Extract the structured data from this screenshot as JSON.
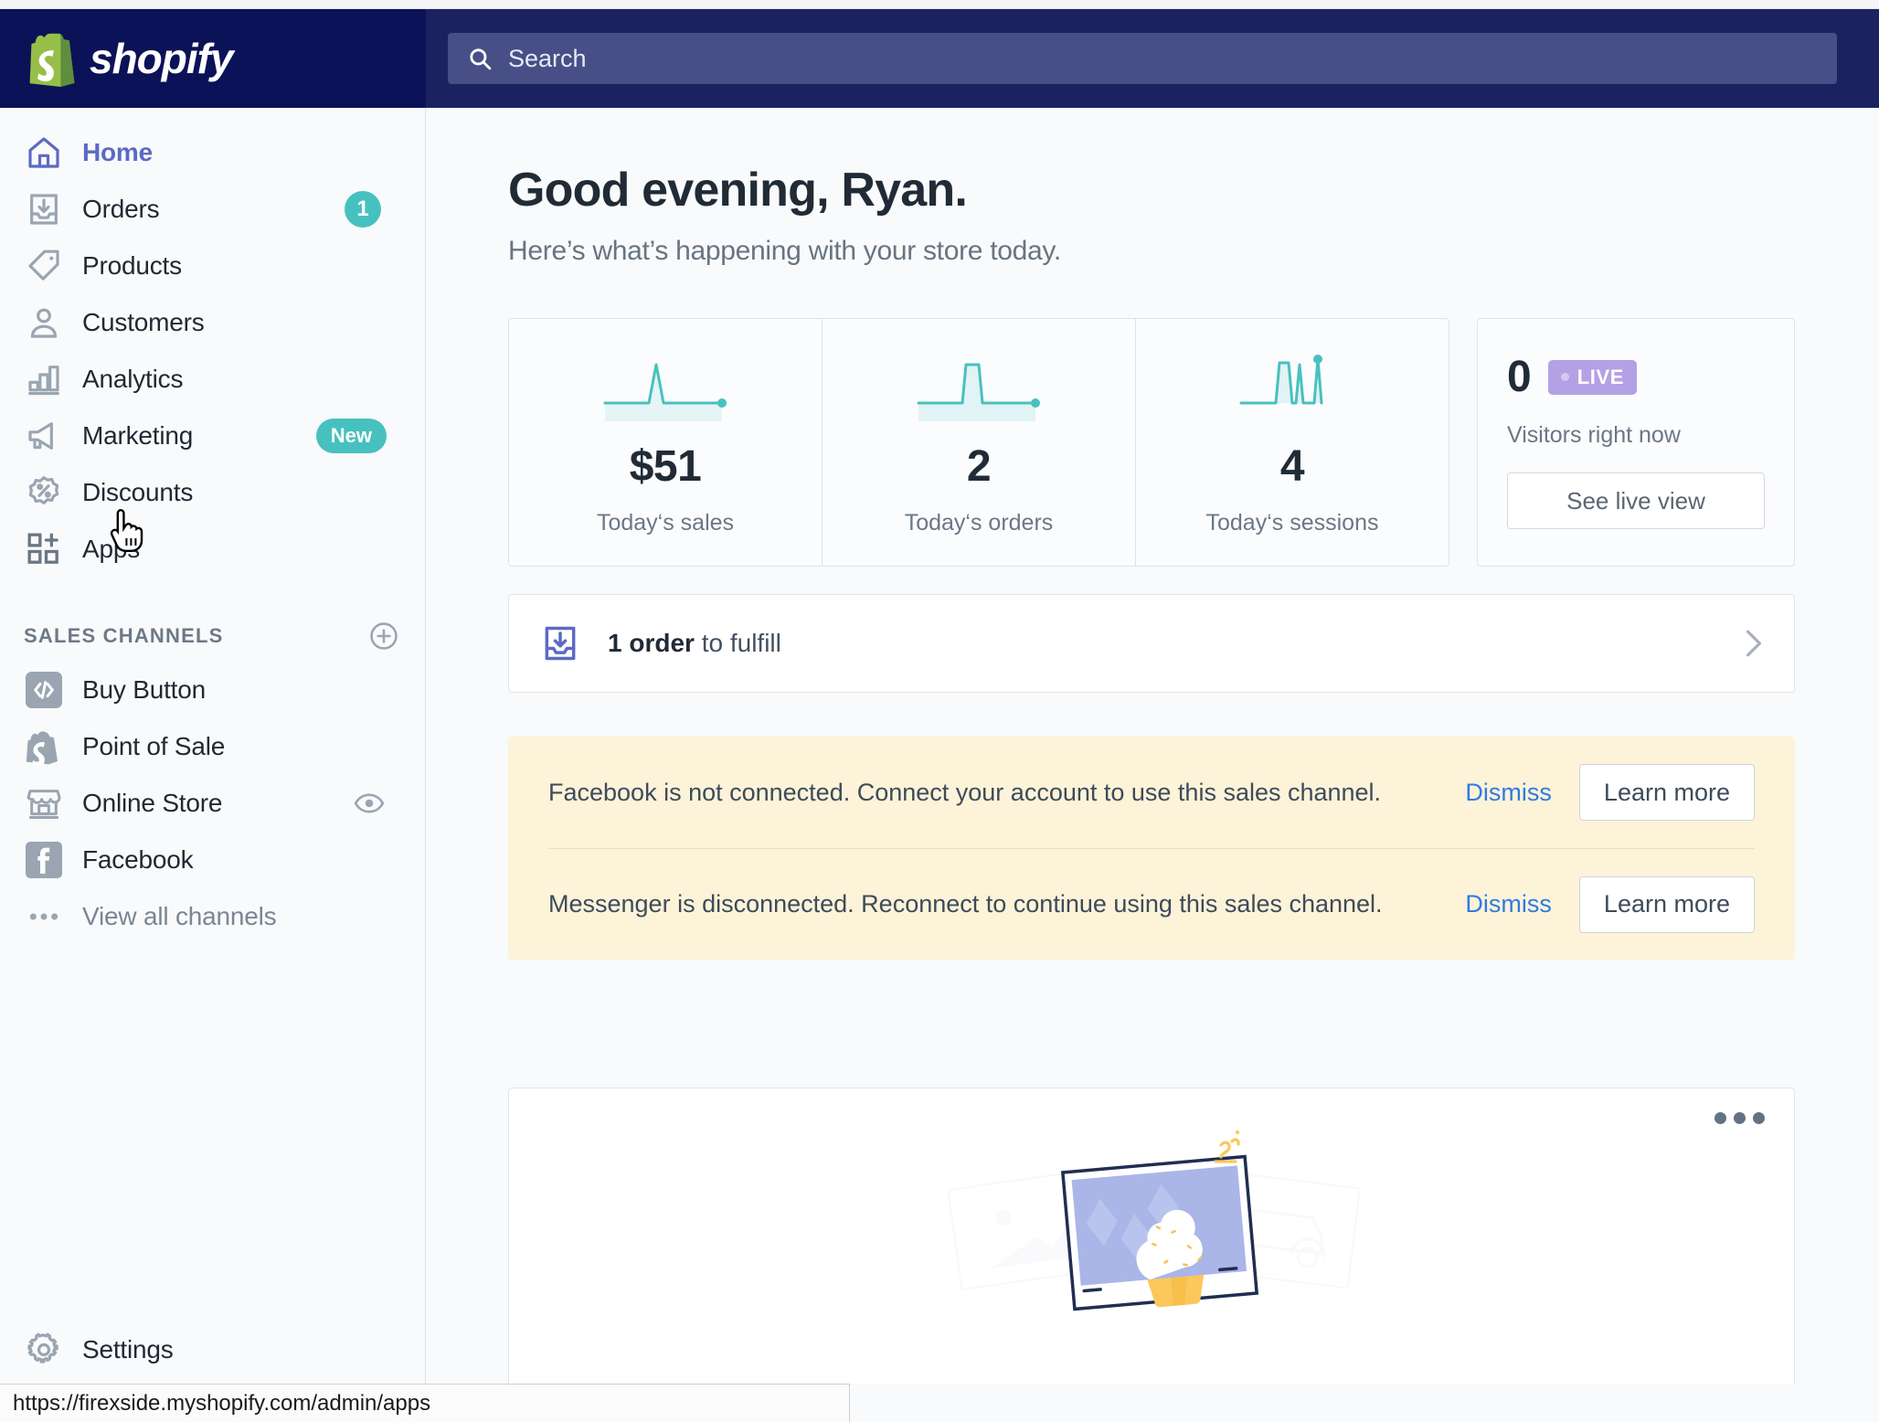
{
  "topbar": {
    "brand": "shopify",
    "search": {
      "placeholder": "Search",
      "value": "",
      "icon": "search-icon"
    }
  },
  "sidebar": {
    "main_items": [
      {
        "label": "Home",
        "icon": "home-icon",
        "active": true,
        "badge": null
      },
      {
        "label": "Orders",
        "icon": "orders-icon",
        "active": false,
        "badge": "1"
      },
      {
        "label": "Products",
        "icon": "tag-icon",
        "active": false,
        "badge": null
      },
      {
        "label": "Customers",
        "icon": "person-icon",
        "active": false,
        "badge": null
      },
      {
        "label": "Analytics",
        "icon": "bar-chart-icon",
        "active": false,
        "badge": null
      },
      {
        "label": "Marketing",
        "icon": "megaphone-icon",
        "active": false,
        "badge": "New"
      },
      {
        "label": "Discounts",
        "icon": "percent-icon",
        "active": false,
        "badge": null
      },
      {
        "label": "Apps",
        "icon": "apps-grid-icon",
        "active": false,
        "badge": null
      }
    ],
    "section": {
      "title": "SALES CHANNELS",
      "add_icon": "plus-circle-icon"
    },
    "channels": [
      {
        "label": "Buy Button",
        "icon": "code-icon"
      },
      {
        "label": "Point of Sale",
        "icon": "pos-bag-icon"
      },
      {
        "label": "Online Store",
        "icon": "storefront-icon",
        "trailing_icon": "eye-icon"
      },
      {
        "label": "Facebook",
        "icon": "facebook-icon"
      }
    ],
    "view_all": {
      "label": "View all channels",
      "icon": "ellipsis-icon"
    },
    "settings": {
      "label": "Settings",
      "icon": "gear-icon"
    }
  },
  "main": {
    "greeting": "Good evening, Ryan.",
    "subgreeting": "Here’s what’s happening with your store today.",
    "stats": [
      {
        "value": "$51",
        "label": "Today‘s sales"
      },
      {
        "value": "2",
        "label": "Today‘s orders"
      },
      {
        "value": "4",
        "label": "Today‘s sessions"
      }
    ],
    "live": {
      "count": "0",
      "badge": "LIVE",
      "caption": "Visitors right now",
      "button": "See live view"
    },
    "fulfill": {
      "bold": "1 order",
      "rest": " to fulfill",
      "icon": "orders-icon",
      "chevron": "chevron-right-icon"
    },
    "banners": [
      {
        "message": "Facebook is not connected. Connect your account to use this sales channel.",
        "dismiss": "Dismiss",
        "action": "Learn more"
      },
      {
        "message": "Messenger is disconnected. Reconnect to continue using this sales channel.",
        "dismiss": "Dismiss",
        "action": "Learn more"
      }
    ],
    "photo_card": {
      "menu_icon": "ellipsis-icon",
      "illustration": "cupcake-photo-illustration"
    }
  },
  "statusbar": {
    "url": "https://firexside.myshopify.com/admin/apps"
  },
  "colors": {
    "brand_navy": "#0b1258",
    "topbar_navy": "#1c2260",
    "search_field": "#474f86",
    "accent_indigo": "#5c6ac4",
    "badge_teal": "#47c1bf",
    "live_purple": "#b4a0e5",
    "banner_cream": "#fcf3d9",
    "link_blue": "#2d7ce0",
    "spark_teal": "#47c1bf"
  },
  "chart_data": [
    {
      "type": "line",
      "title": "Today‘s sales",
      "x": [
        0,
        1,
        2,
        3,
        4,
        5,
        6,
        7,
        8,
        9,
        10
      ],
      "values": [
        0,
        0,
        0,
        0,
        0,
        0,
        1,
        0,
        0,
        0,
        0
      ],
      "ylim": [
        0,
        1
      ],
      "grid": false,
      "annotation": "end-point marker at final value"
    },
    {
      "type": "line",
      "title": "Today‘s orders",
      "x": [
        0,
        1,
        2,
        3,
        4,
        5,
        6,
        7,
        8,
        9,
        10
      ],
      "values": [
        0,
        0,
        0,
        0,
        0,
        0,
        1,
        0,
        0,
        0,
        0
      ],
      "ylim": [
        0,
        1
      ],
      "grid": false,
      "annotation": "end-point marker at final value"
    },
    {
      "type": "line",
      "title": "Today‘s sessions",
      "x": [
        0,
        1,
        2,
        3,
        4,
        5,
        6,
        7,
        8,
        9,
        10
      ],
      "values": [
        0,
        0,
        0,
        0,
        1,
        0.95,
        0,
        1,
        0,
        1,
        0
      ],
      "ylim": [
        0,
        1
      ],
      "grid": false,
      "annotation": "end-point marker on last peak"
    }
  ]
}
